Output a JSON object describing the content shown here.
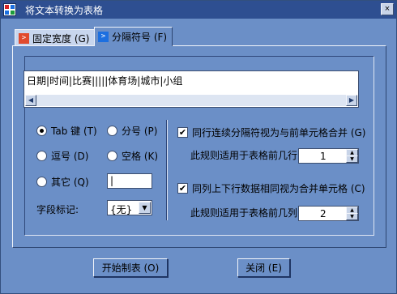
{
  "window": {
    "title": "将文本转换为表格"
  },
  "tabs": [
    {
      "label": "固定宽度 (G)",
      "icon": "fixed-width-icon"
    },
    {
      "label": "分隔符号 (F)",
      "icon": "delimiter-icon"
    }
  ],
  "preview": {
    "text": "日期|时间|比赛|||||体育场|城市|小组"
  },
  "delimiters": {
    "tab": "Tab 键 (T)",
    "semicolon": "分号 (P)",
    "comma": "逗号 (D)",
    "space": "空格 (K)",
    "other": "其它 (Q)",
    "other_value": "|",
    "selected": "tab"
  },
  "field_marker": {
    "label": "字段标记:",
    "value": "{无}"
  },
  "row_merge": {
    "label": "同行连续分隔符视为与前单元格合并 (G)",
    "checked": true,
    "rows_label": "此规则适用于表格前几行:",
    "rows_value": "1"
  },
  "col_merge": {
    "label": "同列上下行数据相同视为合并单元格 (C)",
    "checked": true,
    "cols_label": "此规则适用于表格前几列:",
    "cols_value": "2"
  },
  "buttons": {
    "start": "开始制表 (O)",
    "close": "关闭 (E)"
  },
  "close_glyph": "×",
  "colors": {
    "window_bg": "#6b8fc7",
    "titlebar": "#2e4f91",
    "tab_active_icon": "#1c6fe0",
    "tab_inactive_icon": "#e14b2e"
  }
}
